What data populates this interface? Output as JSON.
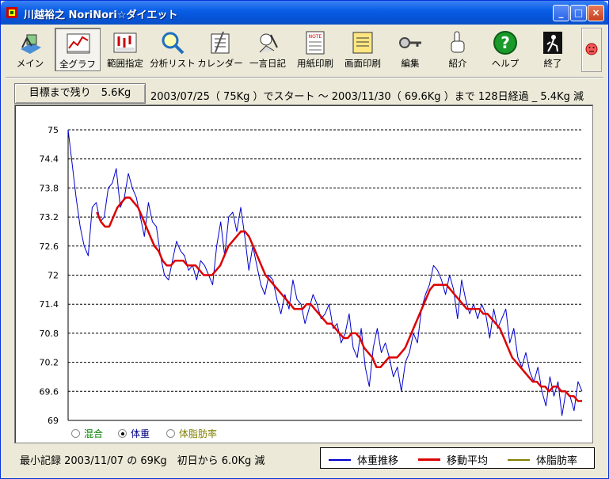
{
  "window": {
    "title": "川越裕之 NoriNori☆ダイエット",
    "minimize": "_",
    "maximize": "□",
    "close": "×"
  },
  "toolbar": [
    {
      "label": "メイン",
      "icon": "main-icon"
    },
    {
      "label": "全グラフ",
      "icon": "graph-icon",
      "active": true
    },
    {
      "label": "範囲指定",
      "icon": "range-icon"
    },
    {
      "label": "分析リスト",
      "icon": "magnifier-icon"
    },
    {
      "label": "カレンダー",
      "icon": "calendar-icon"
    },
    {
      "label": "一言日記",
      "icon": "diary-icon"
    },
    {
      "label": "用紙印刷",
      "icon": "note-icon"
    },
    {
      "label": "画面印刷",
      "icon": "memo-icon"
    },
    {
      "label": "編集",
      "icon": "key-icon"
    },
    {
      "label": "紹介",
      "icon": "pointing-hand-icon"
    },
    {
      "label": "ヘルプ",
      "icon": "help-icon"
    },
    {
      "label": "終了",
      "icon": "exit-icon"
    }
  ],
  "status": {
    "target_remaining": "目標まで残り　5.6Kg",
    "summary": "2003/07/25（ 75Kg ）でスタート ～ 2003/11/30（ 69.6Kg ）まで 128日経過 _ 5.4Kg 減",
    "min_record": "最小記録 2003/11/07 の 69Kg　初日から 6.0Kg 減"
  },
  "modes": [
    {
      "label": "混合",
      "selected": false,
      "color": "#008000"
    },
    {
      "label": "体重",
      "selected": true,
      "color": "#000080"
    },
    {
      "label": "体脂肪率",
      "selected": false,
      "color": "#808000"
    }
  ],
  "legend": [
    {
      "label": "体重推移",
      "color": "#0000cc"
    },
    {
      "label": "移動平均",
      "color": "#dd0000"
    },
    {
      "label": "体脂肪率",
      "color": "#808000"
    }
  ],
  "chart_data": {
    "type": "line",
    "x_start": "2003/07/25",
    "x_end": "2003/11/30",
    "ylim": [
      69,
      75
    ],
    "y_ticks": [
      "75",
      "74.4",
      "73.8",
      "73.2",
      "72.6",
      "72",
      "71.4",
      "70.8",
      "70.2",
      "69.6",
      "69"
    ],
    "grid": true,
    "series": [
      {
        "name": "体重推移",
        "color": "#0000cc",
        "values": [
          75.0,
          74.3,
          73.6,
          73.0,
          72.6,
          72.4,
          73.4,
          73.5,
          73.1,
          73.2,
          73.8,
          73.9,
          74.2,
          73.4,
          73.6,
          74.1,
          73.8,
          73.6,
          73.2,
          72.8,
          73.5,
          73.1,
          73.0,
          72.4,
          72.0,
          71.9,
          72.3,
          72.7,
          72.5,
          72.4,
          72.1,
          72.2,
          71.9,
          72.3,
          72.2,
          72.0,
          71.8,
          72.6,
          73.1,
          72.4,
          73.2,
          73.3,
          72.9,
          73.4,
          72.8,
          72.1,
          72.6,
          72.2,
          71.8,
          71.6,
          72.0,
          71.9,
          71.5,
          71.2,
          71.6,
          71.3,
          71.9,
          71.5,
          71.4,
          71.0,
          71.3,
          71.6,
          71.4,
          71.1,
          71.2,
          71.4,
          70.9,
          71.0,
          70.6,
          70.8,
          71.2,
          70.5,
          70.3,
          70.9,
          70.1,
          69.7,
          70.5,
          70.9,
          70.4,
          70.6,
          70.3,
          69.9,
          70.1,
          69.6,
          70.2,
          70.4,
          70.8,
          70.6,
          71.3,
          71.6,
          71.8,
          72.2,
          72.1,
          71.9,
          71.6,
          72.0,
          71.7,
          71.1,
          71.9,
          71.5,
          71.2,
          71.4,
          71.1,
          71.4,
          71.2,
          70.7,
          71.3,
          70.9,
          71.1,
          71.3,
          70.6,
          70.9,
          70.3,
          70.1,
          70.4,
          70.0,
          69.8,
          70.1,
          69.6,
          69.3,
          69.9,
          69.5,
          69.8,
          69.1,
          69.6,
          69.5,
          69.2,
          69.8,
          69.6
        ]
      },
      {
        "name": "移動平均",
        "color": "#dd0000",
        "values": [
          null,
          null,
          null,
          null,
          null,
          null,
          null,
          73.3,
          73.1,
          73.0,
          73.0,
          73.2,
          73.4,
          73.5,
          73.6,
          73.6,
          73.5,
          73.4,
          73.2,
          73.0,
          72.8,
          72.6,
          72.5,
          72.3,
          72.2,
          72.2,
          72.3,
          72.3,
          72.3,
          72.2,
          72.2,
          72.2,
          72.1,
          72.0,
          72.0,
          72.0,
          72.1,
          72.2,
          72.4,
          72.6,
          72.7,
          72.8,
          72.9,
          72.9,
          72.8,
          72.6,
          72.4,
          72.2,
          72.0,
          71.9,
          71.8,
          71.7,
          71.6,
          71.5,
          71.4,
          71.3,
          71.3,
          71.3,
          71.4,
          71.4,
          71.3,
          71.2,
          71.1,
          71.0,
          71.0,
          70.9,
          70.8,
          70.7,
          70.7,
          70.8,
          70.8,
          70.7,
          70.5,
          70.4,
          70.3,
          70.1,
          70.1,
          70.2,
          70.3,
          70.3,
          70.3,
          70.4,
          70.5,
          70.7,
          70.9,
          71.1,
          71.3,
          71.5,
          71.7,
          71.8,
          71.8,
          71.8,
          71.8,
          71.7,
          71.6,
          71.5,
          71.4,
          71.3,
          71.3,
          71.3,
          71.3,
          71.2,
          71.2,
          71.1,
          71.0,
          70.9,
          70.7,
          70.5,
          70.3,
          70.2,
          70.1,
          70.0,
          69.9,
          69.8,
          69.8,
          69.7,
          69.7,
          69.6,
          69.7,
          69.7,
          69.6,
          69.6,
          69.5,
          69.5,
          69.4,
          69.4
        ]
      }
    ]
  }
}
